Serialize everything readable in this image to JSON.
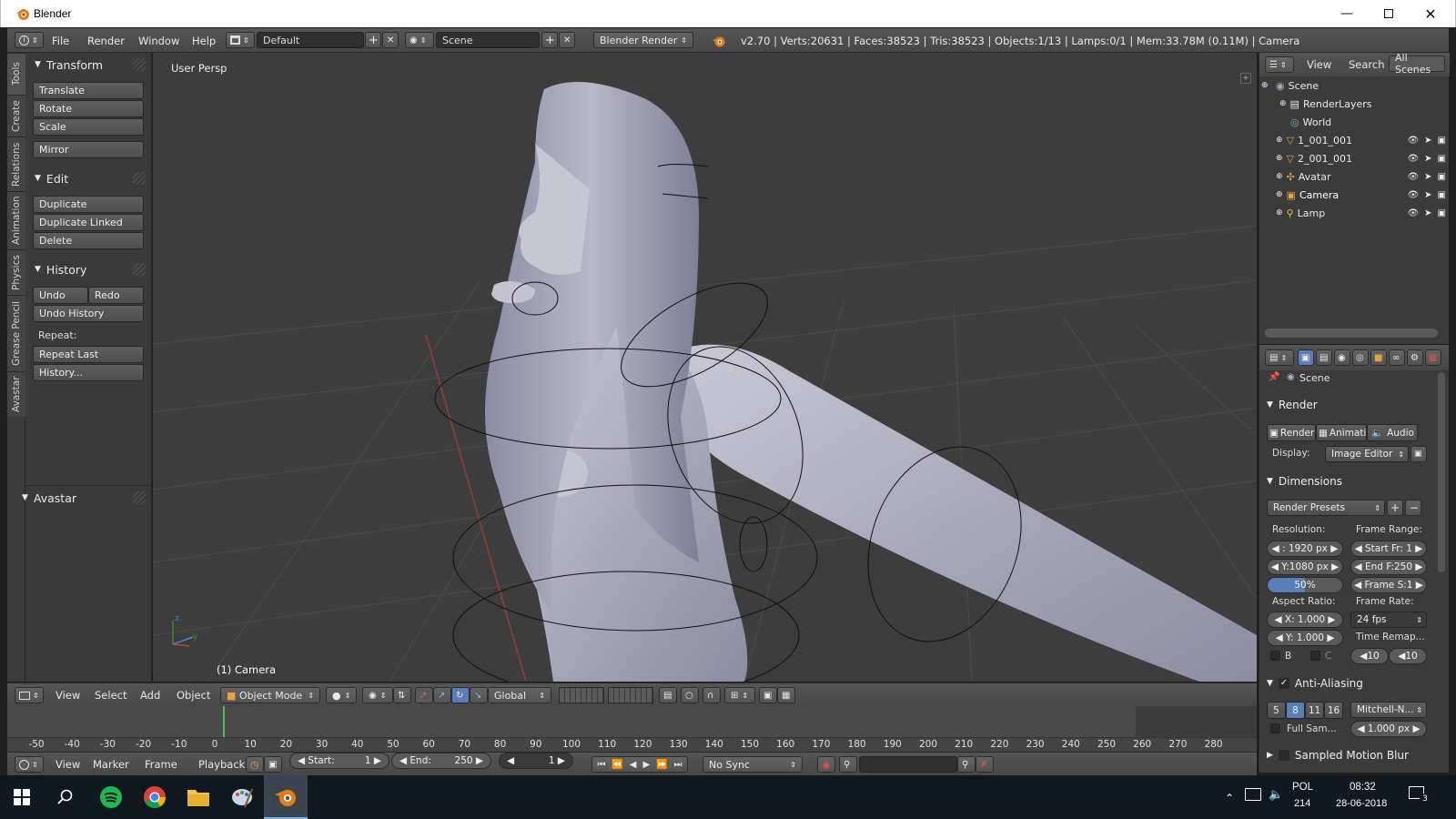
{
  "window": {
    "title": "Blender"
  },
  "info_header": {
    "menus": [
      "File",
      "Render",
      "Window",
      "Help"
    ],
    "screen_layout": "Default",
    "scene": "Scene",
    "engine": "Blender Render",
    "stats": "v2.70 | Verts:20631 | Faces:38523 | Tris:38523 | Objects:1/13 | Lamps:0/1 | Mem:33.78M (0.11M) | Camera"
  },
  "tool_tabs": [
    "Tools",
    "Create",
    "Relations",
    "Animation",
    "Physics",
    "Grease Pencil",
    "Avastar"
  ],
  "tools": {
    "transform_title": "Transform",
    "translate": "Translate",
    "rotate": "Rotate",
    "scale": "Scale",
    "mirror": "Mirror",
    "edit_title": "Edit",
    "duplicate": "Duplicate",
    "duplicate_linked": "Duplicate Linked",
    "delete": "Delete",
    "history_title": "History",
    "undo": "Undo",
    "redo": "Redo",
    "undo_history": "Undo History",
    "repeat_label": "Repeat:",
    "repeat_last": "Repeat Last",
    "history_btn": "History...",
    "avastar_title": "Avastar"
  },
  "viewport": {
    "label": "User Persp",
    "object_label": "(1) Camera"
  },
  "view3d_header": {
    "menus": [
      "View",
      "Select",
      "Add",
      "Object"
    ],
    "mode": "Object Mode",
    "orientation": "Global"
  },
  "timeline": {
    "ticks": [
      "-50",
      "-40",
      "-30",
      "-20",
      "-10",
      "0",
      "10",
      "20",
      "30",
      "40",
      "50",
      "60",
      "70",
      "80",
      "90",
      "100",
      "110",
      "120",
      "130",
      "140",
      "150",
      "160",
      "170",
      "180",
      "190",
      "200",
      "210",
      "220",
      "230",
      "240",
      "250",
      "260",
      "270",
      "280"
    ],
    "current_frame": 1
  },
  "timeline_header": {
    "menus": [
      "View",
      "Marker",
      "Frame",
      "Playback"
    ],
    "start_label": "Start:",
    "start": "1",
    "end_label": "End:",
    "end": "250",
    "current": "1",
    "sync": "No Sync"
  },
  "outliner": {
    "header": {
      "view": "View",
      "search": "Search",
      "filter": "All Scenes"
    },
    "items": [
      {
        "label": "Scene"
      },
      {
        "label": "RenderLayers"
      },
      {
        "label": "World"
      },
      {
        "label": "1_001_001"
      },
      {
        "label": "2_001_001"
      },
      {
        "label": "Avatar"
      },
      {
        "label": "Camera"
      },
      {
        "label": "Lamp"
      }
    ]
  },
  "properties": {
    "context": "Scene",
    "render_title": "Render",
    "render_btn": "Render",
    "anim_btn": "Animati",
    "audio_btn": "Audio",
    "display_label": "Display:",
    "display_value": "Image Editor",
    "dimensions_title": "Dimensions",
    "render_presets": "Render Presets",
    "resolution_label": "Resolution:",
    "res_x": "1920 px",
    "res_y": "Y:1080 px",
    "res_pct": "50%",
    "frame_range_label": "Frame Range:",
    "start_fr": "Start Fr: 1",
    "end_fr": "End F:250",
    "frame_step": "Frame S:1",
    "aspect_label": "Aspect Ratio:",
    "aspect_x": "X:  1.000",
    "aspect_y": "Y:  1.000",
    "frame_rate_label": "Frame Rate:",
    "fps": "24 fps",
    "time_remap": "Time Remap...",
    "remap_old": "10",
    "remap_new": "10",
    "border_b": "B",
    "crop_c": "C",
    "aa_title": "Anti-Aliasing",
    "aa_samples": [
      "5",
      "8",
      "11",
      "16"
    ],
    "aa_active": "8",
    "aa_filter": "Mitchell-N...",
    "full_sample": "Full Sam...",
    "filter_size": "1.000 px",
    "motion_blur_title": "Sampled Motion Blur"
  },
  "taskbar": {
    "lang": "POL",
    "lang_sub": "214",
    "time": "08:32",
    "date": "28-06-2018",
    "notifications": "3"
  }
}
